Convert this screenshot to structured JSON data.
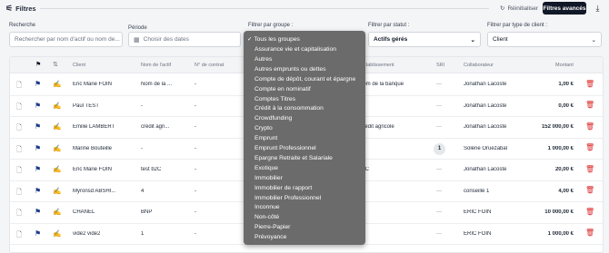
{
  "header": {
    "title": "Filtres",
    "filter_icon": "sliders-icon",
    "reset_label": "Réinitialiser",
    "advanced_label": "Filtres avancés",
    "download_icon": "download-icon"
  },
  "filters": {
    "search_label": "Recherche",
    "search_placeholder": "Rechercher par nom d'actif ou nom de...",
    "period_label": "Période",
    "period_placeholder": "Choisir des dates",
    "group_label": "Filtrer par groupe :",
    "status_label": "Filtrer par statut :",
    "status_value": "Actifs gérés",
    "client_type_label": "Filtrer par type de client :",
    "client_type_value": "Client"
  },
  "table": {
    "columns": [
      "Client",
      "Nom de l'actif",
      "N° de contrat",
      "Établissement",
      "SRI",
      "Collaborateur",
      "Montant"
    ],
    "rows": [
      {
        "client": "Eric Marie FOIN",
        "asset": "Nom de la ...",
        "contract": "-",
        "institution": "Nom de la banque",
        "sri": "—",
        "collab": "Jonathan Lacoste",
        "amount": "1,00 €"
      },
      {
        "client": "Paul TEST",
        "asset": "-",
        "contract": "-",
        "institution": "",
        "sri": "—",
        "collab": "Jonathan Lacoste",
        "amount": "0,00 €"
      },
      {
        "client": "Emilie LAMBERT",
        "asset": "crédit agri...",
        "contract": "-",
        "institution": "Crédit agricole",
        "sri": "—",
        "collab": "Jonathan Lacoste",
        "amount": "152 000,00 €"
      },
      {
        "client": "Marine Bouteille",
        "asset": "-",
        "contract": "-",
        "institution": "",
        "sri": "1",
        "collab": "Solène Oruezabal",
        "amount": "1 000,00 €"
      },
      {
        "client": "Eric Marie FOIN",
        "asset": "test b2C",
        "contract": "-",
        "institution": "b2C",
        "sri": "—",
        "collab": "Jonathan Lacoste",
        "amount": "20,00 €"
      },
      {
        "client": "Myronsd ABSHI...",
        "asset": "4",
        "contract": "-",
        "institution": "",
        "sri": "—",
        "collab": "conseillé 1",
        "amount": "4,00 €"
      },
      {
        "client": "CHANEL",
        "asset": "BNP",
        "contract": "-",
        "institution": "",
        "sri": "—",
        "collab": "ERIC FOIN",
        "amount": "10 000,00 €"
      },
      {
        "client": "vide2 vide2",
        "asset": "1",
        "contract": "-",
        "institution": "",
        "sri": "—",
        "collab": "ERIC FOIN",
        "amount": "1 000,00 €"
      }
    ]
  },
  "group_dropdown": {
    "selected": "✓ Tous les groupes",
    "options": [
      "Assurance vie et capitalisation",
      "Autres",
      "Autres emprunts ou dettes",
      "Compte de dépôt, courant et épargne",
      "Compte en nominatif",
      "Comptes Titres",
      "Crédit à la consommation",
      "Crowdfunding",
      "Crypto",
      "Emprunt",
      "Emprunt Professionnel",
      "Epargne Retraite et Salariale",
      "Exotique",
      "Immobilier",
      "Immobilier de rapport",
      "Immobilier Professionnel",
      "Inconnue",
      "Non-côté",
      "Pierre-Papier",
      "Prévoyance"
    ]
  },
  "colors": {
    "accent": "#1d3a8a",
    "danger": "#dc2626",
    "dark": "#111827"
  }
}
